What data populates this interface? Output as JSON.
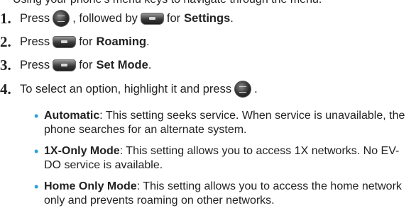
{
  "top_cut_text": "Using your phone's menu keys to navigate through the menu.",
  "steps": [
    {
      "number": "1.",
      "press": "Press",
      "middle": ", followed by",
      "for": "for",
      "target": "Settings",
      "end": "."
    },
    {
      "number": "2.",
      "press": "Press",
      "for": "for",
      "target": "Roaming",
      "end": "."
    },
    {
      "number": "3.",
      "press": "Press",
      "for": "for",
      "target": "Set Mode",
      "end": "."
    },
    {
      "number": "4.",
      "text": "To select an option, highlight it and press",
      "end": "."
    }
  ],
  "keys": {
    "menu_ok_icon": "menu-ok-key-icon",
    "settings_icon": "settings-9-key-icon",
    "roaming_icon": "5-key-icon",
    "set_mode_icon": "1-key-icon"
  },
  "options": [
    {
      "term": "Automatic",
      "text": ": This setting seeks service. When service is unavailable, the phone searches for an alternate system."
    },
    {
      "term": "1X-Only Mode",
      "text": ": This setting allows you to access 1X networks. No EV-DO service is available."
    },
    {
      "term": "Home Only Mode",
      "text": ": This setting allows you to access the home network only and prevents roaming on other networks."
    }
  ],
  "colors": {
    "bullet": "#2aa0d8",
    "text": "#222222"
  }
}
